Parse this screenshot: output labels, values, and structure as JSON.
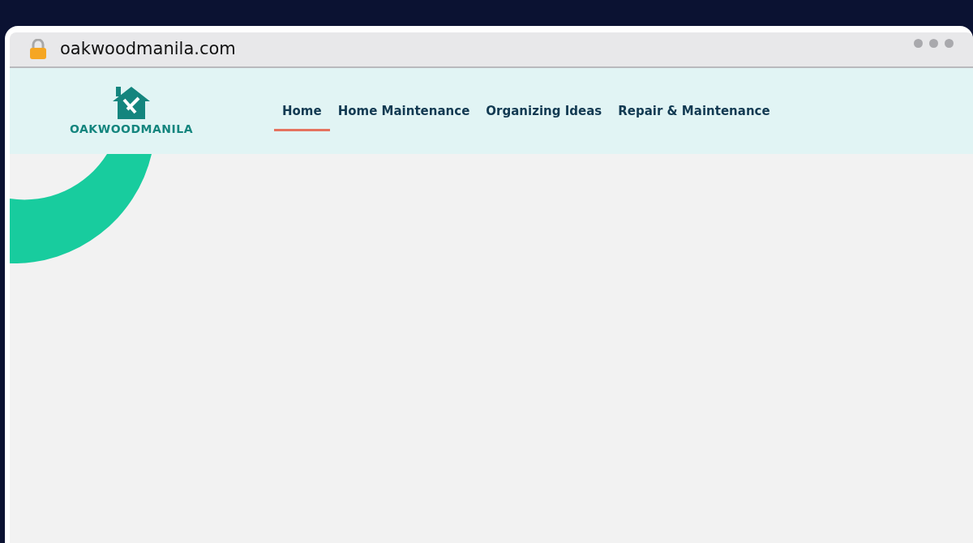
{
  "browser": {
    "address": "oakwoodmanila.com"
  },
  "site": {
    "logo_text": "OAKWOODMANILA",
    "nav": [
      {
        "label": "Home",
        "selected": true
      },
      {
        "label": "Home Maintenance",
        "selected": false
      },
      {
        "label": "Organizing Ideas",
        "selected": false
      },
      {
        "label": "Repair & Maintenance",
        "selected": false
      }
    ]
  }
}
